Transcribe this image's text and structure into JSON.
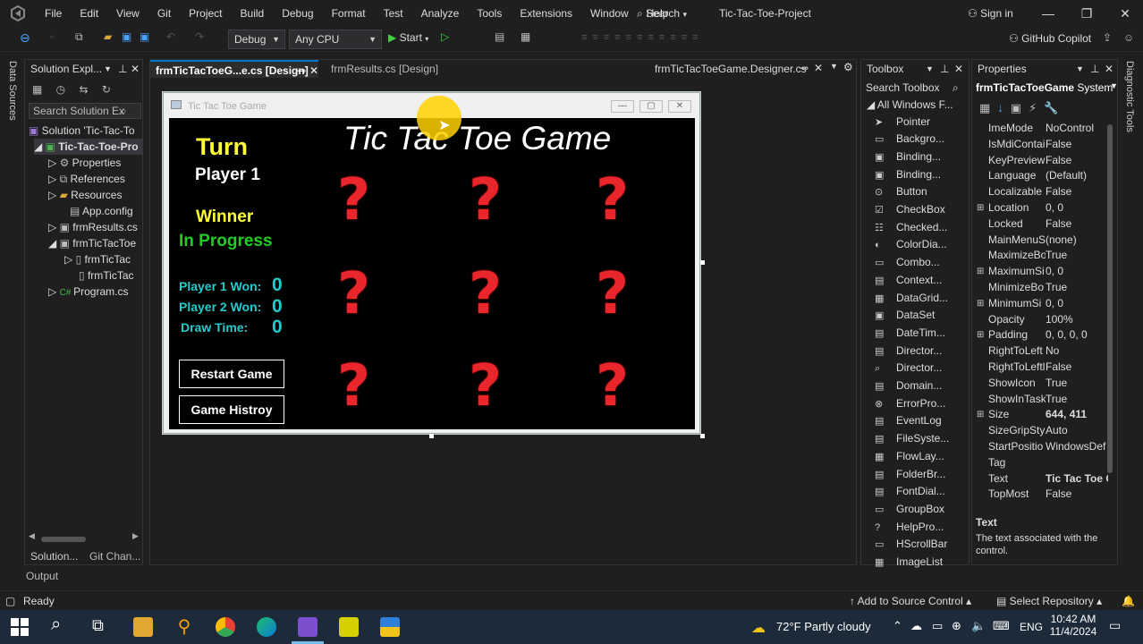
{
  "menubar": {
    "items": [
      "File",
      "Edit",
      "View",
      "Git",
      "Project",
      "Build",
      "Debug",
      "Format",
      "Test",
      "Analyze",
      "Tools",
      "Extensions",
      "Window",
      "Help"
    ],
    "search_label": "Search",
    "project_title": "Tic-Tac-Toe-Project",
    "sign_in": "Sign in"
  },
  "toolbar": {
    "config": "Debug",
    "platform": "Any CPU",
    "start_label": "Start",
    "copilot": "GitHub Copilot"
  },
  "side_tabs": {
    "left": "Data Sources",
    "right": "Diagnostic Tools"
  },
  "solution_explorer": {
    "title": "Solution Expl...",
    "search_placeholder": "Search Solution Ex",
    "items": [
      "Solution 'Tic-Tac-To",
      "Tic-Tac-Toe-Pro",
      "Properties",
      "References",
      "Resources",
      "App.config",
      "frmResults.cs",
      "frmTicTacToe",
      "frmTicTac",
      "frmTicTac",
      "Program.cs"
    ],
    "bottom_tabs": [
      "Solution...",
      "Git Chan..."
    ]
  },
  "output_label": "Output",
  "editor": {
    "tabs": [
      "frmTicTacToeG...e.cs [Design]",
      "frmResults.cs [Design]"
    ],
    "right_tab": "frmTicTacToeGame.Designer.cs"
  },
  "form": {
    "window_title": "Tic Tac Toe Game",
    "heading": "Tic Tac Toe Game",
    "turn_label": "Turn",
    "player_label": "Player 1",
    "winner_label": "Winner",
    "status": "In Progress",
    "p1_label": "Player 1 Won:",
    "p1_score": "0",
    "p2_label": "Player 2 Won:",
    "p2_score": "0",
    "draw_label": "Draw Time:",
    "draw_score": "0",
    "restart_button": "Restart Game",
    "history_button": "Game Histroy",
    "cells": [
      "?",
      "?",
      "?",
      "?",
      "?",
      "?",
      "?",
      "?",
      "?"
    ]
  },
  "toolbox": {
    "title": "Toolbox",
    "search_placeholder": "Search Toolbox",
    "group": "All Windows F...",
    "items": [
      "Pointer",
      "Backgro...",
      "Binding...",
      "Binding...",
      "Button",
      "CheckBox",
      "Checked...",
      "ColorDia...",
      "Combo...",
      "Context...",
      "DataGrid...",
      "DataSet",
      "DateTim...",
      "Director...",
      "Director...",
      "Domain...",
      "ErrorPro...",
      "EventLog",
      "FileSyste...",
      "FlowLay...",
      "FolderBr...",
      "FontDial...",
      "GroupBox",
      "HelpPro...",
      "HScrollBar",
      "ImageList"
    ]
  },
  "properties": {
    "title": "Properties",
    "object": "frmTicTacToeGame",
    "object_type": "System",
    "rows": [
      {
        "name": "ImeMode",
        "value": "NoControl",
        "expand": ""
      },
      {
        "name": "IsMdiContai",
        "value": "False",
        "expand": ""
      },
      {
        "name": "KeyPreview",
        "value": "False",
        "expand": ""
      },
      {
        "name": "Language",
        "value": "(Default)",
        "expand": ""
      },
      {
        "name": "Localizable",
        "value": "False",
        "expand": ""
      },
      {
        "name": "Location",
        "value": "0, 0",
        "expand": "⊞"
      },
      {
        "name": "Locked",
        "value": "False",
        "expand": ""
      },
      {
        "name": "MainMenuS",
        "value": "(none)",
        "expand": ""
      },
      {
        "name": "MaximizeBo",
        "value": "True",
        "expand": ""
      },
      {
        "name": "MaximumSi",
        "value": "0, 0",
        "expand": "⊞"
      },
      {
        "name": "MinimizeBo",
        "value": "True",
        "expand": ""
      },
      {
        "name": "MinimumSi",
        "value": "0, 0",
        "expand": "⊞"
      },
      {
        "name": "Opacity",
        "value": "100%",
        "expand": ""
      },
      {
        "name": "Padding",
        "value": "0, 0, 0, 0",
        "expand": "⊞"
      },
      {
        "name": "RightToLeft",
        "value": "No",
        "expand": ""
      },
      {
        "name": "RightToLeftl",
        "value": "False",
        "expand": ""
      },
      {
        "name": "ShowIcon",
        "value": "True",
        "expand": ""
      },
      {
        "name": "ShowInTaskl",
        "value": "True",
        "expand": ""
      },
      {
        "name": "Size",
        "value": "644, 411",
        "expand": "⊞"
      },
      {
        "name": "SizeGripStyl",
        "value": "Auto",
        "expand": ""
      },
      {
        "name": "StartPositio",
        "value": "WindowsDef",
        "expand": ""
      },
      {
        "name": "Tag",
        "value": "",
        "expand": ""
      },
      {
        "name": "Text",
        "value": "Tic Tac Toe G",
        "expand": ""
      },
      {
        "name": "TopMost",
        "value": "False",
        "expand": ""
      }
    ],
    "desc_title": "Text",
    "desc_body": "The text associated with the control."
  },
  "statusbar": {
    "ready": "Ready",
    "source_control": "Add to Source Control",
    "repo": "Select Repository"
  },
  "taskbar": {
    "weather": "72°F  Partly cloudy",
    "lang": "ENG",
    "time": "10:42 AM",
    "date": "11/4/2024"
  },
  "colors": {
    "accent": "#007acc",
    "red_q": "#e8262c",
    "yellow": "#ffff33",
    "green": "#22cc22",
    "cyan": "#22cccc"
  }
}
